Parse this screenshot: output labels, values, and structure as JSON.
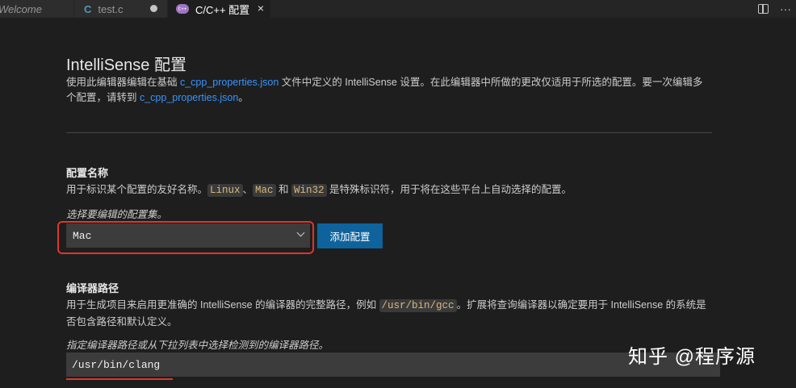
{
  "tabs": [
    {
      "label": "Welcome"
    },
    {
      "label": "test.c",
      "icon": "c-file-icon",
      "modified": true
    },
    {
      "label": "C/C++ 配置",
      "icon": "config-icon",
      "active": true
    }
  ],
  "tab_icon_text": {
    "c": "C",
    "cfg": "C++"
  },
  "title": "IntelliSense 配置",
  "description": {
    "part1": "使用此编辑器编辑在基础 ",
    "link1": "c_cpp_properties.json",
    "part2": " 文件中定义的 IntelliSense 设置。在此编辑器中所做的更改仅适用于所选的配置。要一次编辑多个配置，请转到 ",
    "link2": "c_cpp_properties.json",
    "part3": "。"
  },
  "config_name": {
    "title": "配置名称",
    "desc_part1": "用于标识某个配置的友好名称。",
    "kw1": "Linux",
    "sep": "、",
    "kw2": "Mac",
    "and": " 和 ",
    "kw3": "Win32",
    "desc_part2": " 是特殊标识符，用于将在这些平台上自动选择的配置。",
    "hint": "选择要编辑的配置集。",
    "selected": "Mac",
    "add_button": "添加配置"
  },
  "compiler_path": {
    "title": "编译器路径",
    "desc_part1": "用于生成项目来启用更准确的 IntelliSense 的编译器的完整路径，例如 ",
    "kw": "/usr/bin/gcc",
    "desc_part2": "。扩展将查询编译器以确定要用于 IntelliSense 的系统是否包含路径和默认定义。",
    "hint": "指定编译器路径或从下拉列表中选择检测到的编译器路径。",
    "value": "/usr/bin/clang"
  },
  "watermark": "知乎 @程序源",
  "icons": {
    "close": "×",
    "more": "···"
  },
  "colors": {
    "accent_button": "#0e639c",
    "highlight_red": "#e0352b",
    "link": "#3794ff"
  }
}
